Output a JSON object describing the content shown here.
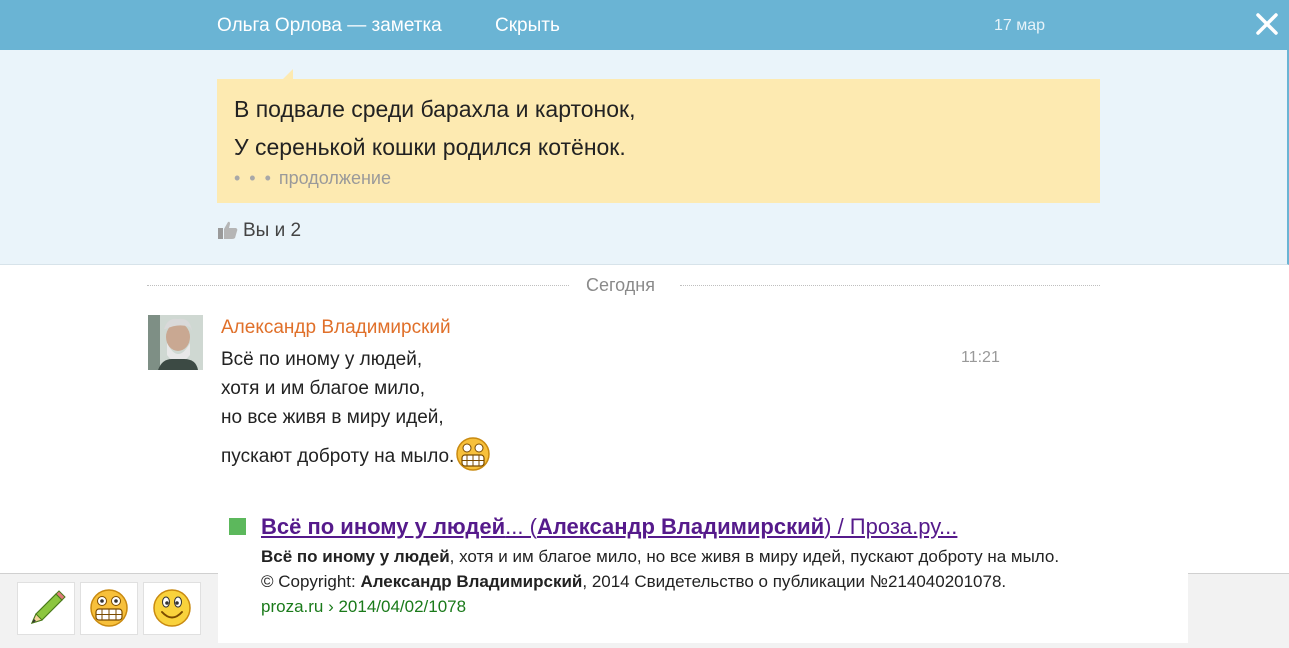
{
  "header": {
    "title": "Ольга Орлова — заметка",
    "hide_label": "Скрыть",
    "date": "17 мар"
  },
  "note": {
    "line1": "В подвале среди барахла и картонок,",
    "line2": "У серенькой кошки родился котёнок.",
    "more_dots": "• • •",
    "more_label": "продолжение"
  },
  "likes": {
    "text": "Вы и 2"
  },
  "divider": {
    "label": "Сегодня"
  },
  "message": {
    "author": "Александр Владимирский",
    "time": "11:21",
    "lines": [
      "Всё по иному у людей,",
      "хотя и им благое мило,",
      "но все живя в миру идей,",
      "пускают доброту на мыло."
    ]
  },
  "snippet": {
    "link_a": "Всё по иному у людей",
    "link_b": "... (",
    "link_c": "Александр Владимирский",
    "link_d": ") / Проза.ру...",
    "desc_bold": "Всё по иному у людей",
    "desc_rest": ", хотя и им благое мило, но все живя в миру идей, пускают доброту на мыло.",
    "copy_a": "© Copyright: ",
    "copy_b": "Александр Владимирский",
    "copy_c": ", 2014 Свидетельство о публикации №214040201078.",
    "url": "proza.ru › 2014/04/02/1078"
  },
  "toolbar": {
    "buttons": [
      "pencil-icon",
      "grin-smiley-icon",
      "smile-smiley-icon"
    ]
  },
  "colors": {
    "header_bg": "#6ab4d4",
    "note_bg": "#fdeab1",
    "author": "#e0702a",
    "link": "#551a8b",
    "url": "#1a7a1a"
  }
}
